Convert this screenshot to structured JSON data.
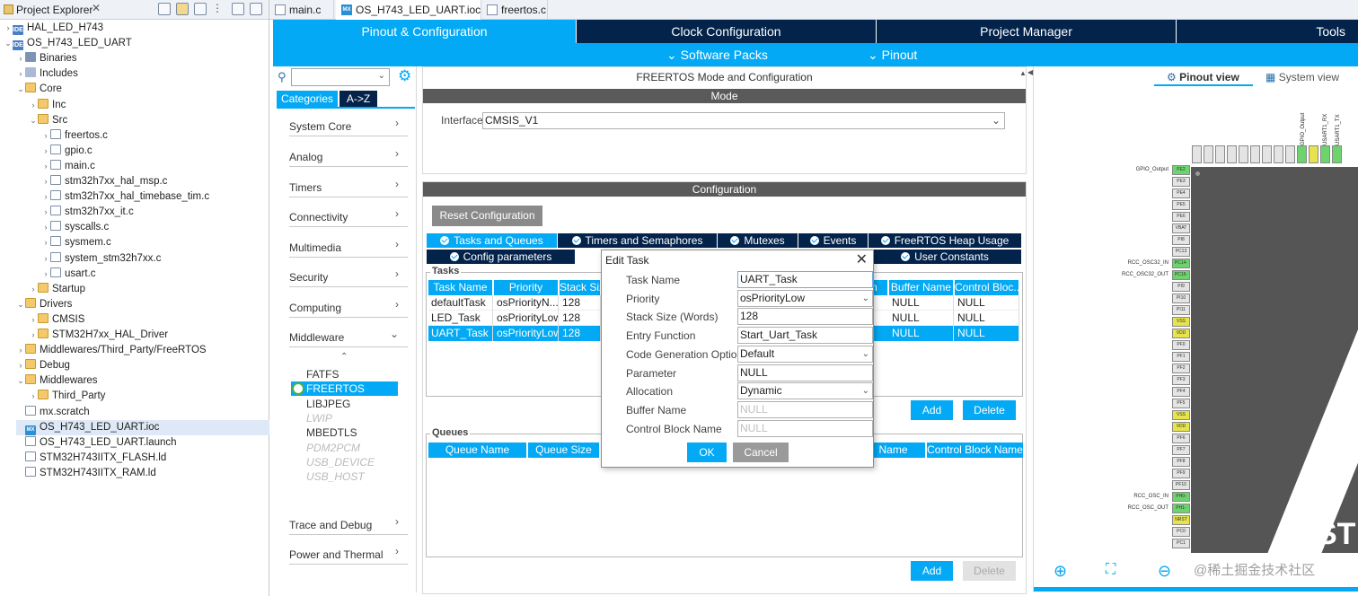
{
  "project_explorer": {
    "title": "Project Explorer",
    "close": "✕",
    "items": [
      {
        "label": "HAL_LED_H743",
        "icon": "project-icon",
        "tw": "›"
      },
      {
        "label": "OS_H743_LED_UART",
        "icon": "project-icon",
        "tw": "⌄"
      },
      {
        "label": "Binaries",
        "icon": "binaries-icon",
        "tw": "›"
      },
      {
        "label": "Includes",
        "icon": "includes-icon",
        "tw": "›"
      },
      {
        "label": "Core",
        "icon": "folder-icon",
        "tw": "⌄"
      },
      {
        "label": "Inc",
        "icon": "folder-icon",
        "tw": "›"
      },
      {
        "label": "Src",
        "icon": "folder-icon",
        "tw": "⌄"
      },
      {
        "label": "freertos.c",
        "icon": "c-file-icon",
        "tw": "›"
      },
      {
        "label": "gpio.c",
        "icon": "c-file-icon",
        "tw": "›"
      },
      {
        "label": "main.c",
        "icon": "c-file-icon",
        "tw": "›"
      },
      {
        "label": "stm32h7xx_hal_msp.c",
        "icon": "c-file-icon",
        "tw": "›"
      },
      {
        "label": "stm32h7xx_hal_timebase_tim.c",
        "icon": "c-file-icon",
        "tw": "›"
      },
      {
        "label": "stm32h7xx_it.c",
        "icon": "c-file-icon",
        "tw": "›"
      },
      {
        "label": "syscalls.c",
        "icon": "c-file-icon",
        "tw": "›"
      },
      {
        "label": "sysmem.c",
        "icon": "c-file-icon",
        "tw": "›"
      },
      {
        "label": "system_stm32h7xx.c",
        "icon": "c-file-icon",
        "tw": "›"
      },
      {
        "label": "usart.c",
        "icon": "c-file-icon",
        "tw": "›"
      },
      {
        "label": "Startup",
        "icon": "folder-icon",
        "tw": "›"
      },
      {
        "label": "Drivers",
        "icon": "folder-icon",
        "tw": "⌄"
      },
      {
        "label": "CMSIS",
        "icon": "folder-icon",
        "tw": "›"
      },
      {
        "label": "STM32H7xx_HAL_Driver",
        "icon": "folder-icon",
        "tw": "›"
      },
      {
        "label": "Middlewares/Third_Party/FreeRTOS",
        "icon": "folder-icon",
        "tw": "›"
      },
      {
        "label": "Debug",
        "icon": "folder-icon",
        "tw": "›"
      },
      {
        "label": "Middlewares",
        "icon": "folder-icon",
        "tw": "⌄"
      },
      {
        "label": "Third_Party",
        "icon": "folder-icon",
        "tw": "›"
      },
      {
        "label": "mx.scratch",
        "icon": "file-icon",
        "tw": ""
      },
      {
        "label": "OS_H743_LED_UART.ioc",
        "icon": "mx-file-icon",
        "tw": ""
      },
      {
        "label": "OS_H743_LED_UART.launch",
        "icon": "file-icon",
        "tw": ""
      },
      {
        "label": "STM32H743IITX_FLASH.ld",
        "icon": "ld-file-icon",
        "tw": ""
      },
      {
        "label": "STM32H743IITX_RAM.ld",
        "icon": "ld-file-icon",
        "tw": ""
      }
    ]
  },
  "editor_tabs": [
    {
      "label": "main.c"
    },
    {
      "label": "OS_H743_LED_UART.ioc",
      "close": "✕"
    },
    {
      "label": "freertos.c"
    }
  ],
  "top_nav": {
    "pinout_config": "Pinout & Configuration",
    "clock_config": "Clock Configuration",
    "project_manager": "Project Manager",
    "tools": "Tools",
    "software_packs": "⌄ Software Packs",
    "pinout": "⌄ Pinout"
  },
  "categories": {
    "tab_categories": "Categories",
    "tab_az": "A->Z",
    "items": [
      "System Core",
      "Analog",
      "Timers",
      "Connectivity",
      "Multimedia",
      "Security",
      "Computing",
      "Middleware"
    ],
    "bottom_items": [
      "Trace and Debug",
      "Power and Thermal"
    ],
    "middleware_items": [
      "FATFS",
      "FREERTOS",
      "LIBJPEG",
      "LWIP",
      "MBEDTLS",
      "PDM2PCM",
      "USB_DEVICE",
      "USB_HOST"
    ],
    "chevron_right": "›",
    "chevron_down": "⌄",
    "scroll_up": "⌃"
  },
  "mode": {
    "header": "FREERTOS Mode and Configuration",
    "band": "Mode",
    "interface_label": "Interface",
    "interface_value": "CMSIS_V1"
  },
  "config": {
    "band": "Configuration",
    "reset_button": "Reset Configuration",
    "tabs_row1": [
      "Tasks and Queues",
      "Timers and Semaphores",
      "Mutexes",
      "Events",
      "FreeRTOS Heap Usage"
    ],
    "tabs_row2": [
      "Config parameters",
      "User Constants"
    ],
    "tasks_legend": "Tasks",
    "tasks_columns": [
      "Task Name",
      "Priority",
      "Stack Siz",
      "n",
      "Buffer Name",
      "Control Bloc..."
    ],
    "tasks_rows": [
      [
        "defaultTask",
        "osPriorityN...",
        "128",
        "NULL",
        "NULL"
      ],
      [
        "LED_Task",
        "osPriorityLow",
        "128",
        "NULL",
        "NULL"
      ],
      [
        "UART_Task",
        "osPriorityLow",
        "128",
        "NULL",
        "NULL"
      ]
    ],
    "add": "Add",
    "delete": "Delete",
    "queues_legend": "Queues",
    "queues_columns": [
      "Queue Name",
      "Queue Size",
      "Name",
      "Control Block Name"
    ]
  },
  "dialog": {
    "title": "Edit Task",
    "close": "✕",
    "fields": [
      {
        "label": "Task Name",
        "value": "UART_Task"
      },
      {
        "label": "Priority",
        "value": "osPriorityLow"
      },
      {
        "label": "Stack Size (Words)",
        "value": "128"
      },
      {
        "label": "Entry Function",
        "value": "Start_Uart_Task"
      },
      {
        "label": "Code Generation Option",
        "value": "Default"
      },
      {
        "label": "Parameter",
        "value": "NULL"
      },
      {
        "label": "Allocation",
        "value": "Dynamic"
      },
      {
        "label": "Buffer Name",
        "value": "NULL"
      },
      {
        "label": "Control Block Name",
        "value": "NULL"
      }
    ],
    "ok": "OK",
    "cancel": "Cancel"
  },
  "pinout": {
    "pinout_view": "Pinout view",
    "system_view": "System view",
    "top_labels": [
      "GPIO_Output",
      "USART1_RX",
      "USART1_TX"
    ],
    "top_pins": [
      "PE1",
      "PE0",
      "PB9",
      "PB8",
      "VDD",
      "VSS",
      "PB7",
      "PB6",
      "PB5",
      "PB4",
      "PB3",
      "PG15",
      "PG14"
    ],
    "side_pins": [
      {
        "pin": "PE2",
        "label": "GPIO_Output"
      },
      {
        "pin": "PE3",
        "label": ""
      },
      {
        "pin": "PE4",
        "label": ""
      },
      {
        "pin": "PE5",
        "label": ""
      },
      {
        "pin": "PE6",
        "label": ""
      },
      {
        "pin": "VBAT",
        "label": ""
      },
      {
        "pin": "PI8",
        "label": ""
      },
      {
        "pin": "PC13",
        "label": ""
      },
      {
        "pin": "PC14-",
        "label": "RCC_OSC32_IN"
      },
      {
        "pin": "PC15-",
        "label": "RCC_OSC32_OUT"
      },
      {
        "pin": "PI9",
        "label": ""
      },
      {
        "pin": "PI10",
        "label": ""
      },
      {
        "pin": "PI11",
        "label": ""
      },
      {
        "pin": "VSS",
        "label": ""
      },
      {
        "pin": "VDD",
        "label": ""
      },
      {
        "pin": "PF0",
        "label": ""
      },
      {
        "pin": "PF1",
        "label": ""
      },
      {
        "pin": "PF2",
        "label": ""
      },
      {
        "pin": "PF3",
        "label": ""
      },
      {
        "pin": "PF4",
        "label": ""
      },
      {
        "pin": "PF5",
        "label": ""
      },
      {
        "pin": "VSS",
        "label": ""
      },
      {
        "pin": "VDD",
        "label": ""
      },
      {
        "pin": "PF6",
        "label": ""
      },
      {
        "pin": "PF7",
        "label": ""
      },
      {
        "pin": "PF8",
        "label": ""
      },
      {
        "pin": "PF9",
        "label": ""
      },
      {
        "pin": "PF10",
        "label": ""
      },
      {
        "pin": "PH0-",
        "label": "RCC_OSC_IN"
      },
      {
        "pin": "PH1-",
        "label": "RCC_OSC_OUT"
      },
      {
        "pin": "NRST",
        "label": ""
      },
      {
        "pin": "PC0",
        "label": ""
      },
      {
        "pin": "PC1",
        "label": ""
      }
    ],
    "chip_text": "ST",
    "watermark": "@稀土掘金技术社区"
  },
  "colors": {
    "accent": "#03a9f4",
    "nav_dark": "#03234b",
    "band_gray": "#5a5a5a",
    "pin_green": "#6dd46d",
    "pin_yellow": "#e6e34f"
  }
}
